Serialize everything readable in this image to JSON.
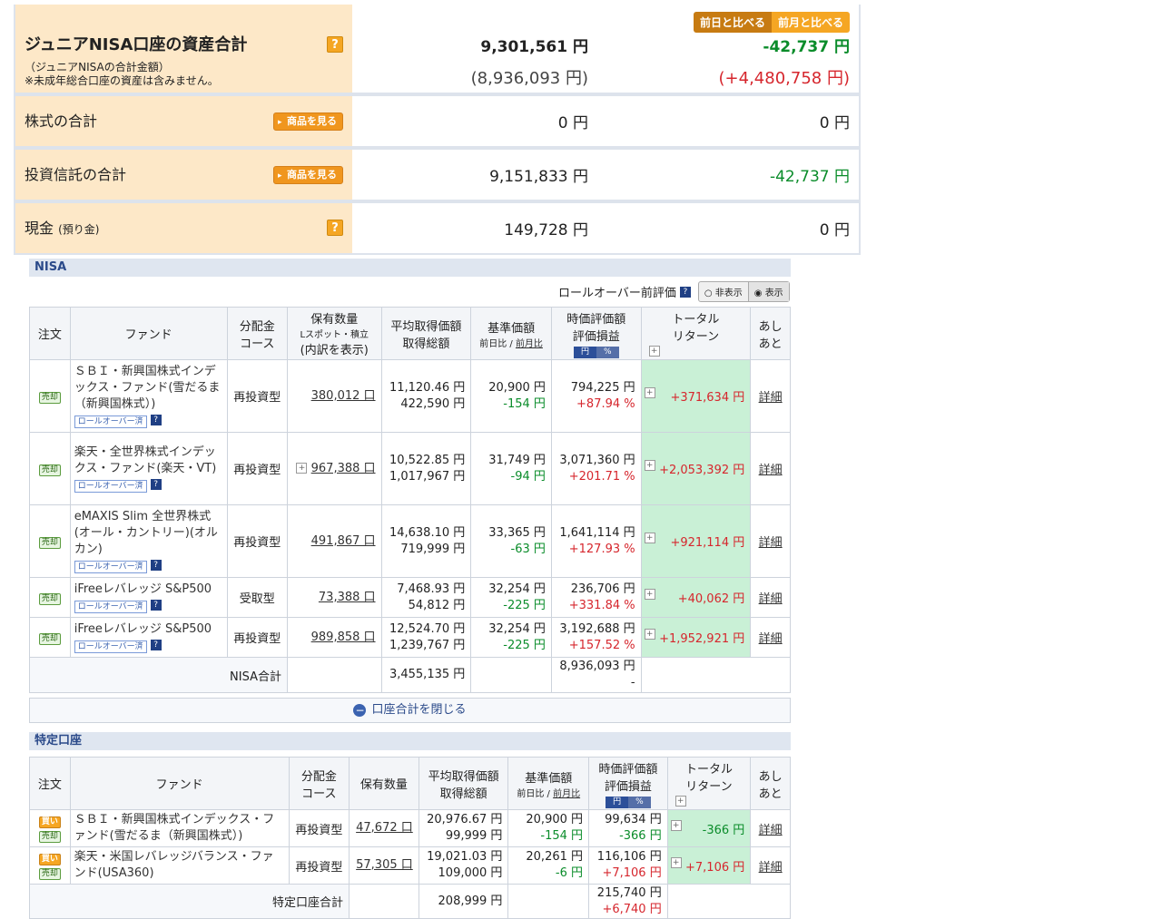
{
  "summary": {
    "total_label": "ジュニアNISA口座の資産合計",
    "total_sub1": "（ジュニアNISAの合計金額）",
    "total_sub2": "※未成年総合口座の資産は含みません。",
    "total_value": "9,301,561 円",
    "total_value_sub": "(8,936,093 円)",
    "total_diff": "-42,737 円",
    "total_diff_sub": "(+4,480,758 円)",
    "cmp_day": "前日と比べる",
    "cmp_month": "前月と比べる",
    "stocks_label": "株式の合計",
    "stocks_value": "0 円",
    "stocks_diff": "0 円",
    "funds_label": "投資信託の合計",
    "funds_value": "9,151,833 円",
    "funds_diff": "-42,737 円",
    "cash_label": "現金",
    "cash_sub": "(預り金)",
    "cash_value": "149,728 円",
    "cash_diff": "0 円",
    "view_products": "商品を見る",
    "q": "?"
  },
  "nisa": {
    "heading": "NISA",
    "rollover_label": "ロールオーバー前評価",
    "toggle_hide": "非表示",
    "toggle_show": "表示",
    "headers": {
      "order": "注文",
      "fund": "ファンド",
      "dist1": "分配金",
      "dist2": "コース",
      "qty": "保有数量",
      "qty_sub": "Lスポット・積立",
      "qty_sub2": "(内訳を表示)",
      "avg1": "平均取得価額",
      "avg2": "取得総額",
      "base1": "基準価額",
      "base2a": "前日比",
      "base2b": "前月比",
      "eval1": "時価評価額",
      "eval2": "評価損益",
      "yen": "円",
      "pct": "%",
      "tr1": "トータル",
      "tr2": "リターン",
      "ashi1": "あし",
      "ashi2": "あと"
    },
    "sell": "売却",
    "rollover_badge": "ロールオーバー済",
    "detail": "詳細",
    "rows": [
      {
        "fund": "ＳＢＩ・新興国株式インデックス・ファンド(雪だるま（新興国株式）)",
        "dist": "再投資型",
        "qty": "380,012 口",
        "avg": "11,120.46 円",
        "cost": "422,590 円",
        "base": "20,900 円",
        "base_diff": "-154 円",
        "eval": "794,225 円",
        "gain_pct": "+87.94 %",
        "total": "+371,634 円"
      },
      {
        "fund": "楽天・全世界株式インデックス・ファンド(楽天・VT)",
        "dist": "再投資型",
        "qty": "967,388 口",
        "avg": "10,522.85 円",
        "cost": "1,017,967 円",
        "base": "31,749 円",
        "base_diff": "-94 円",
        "eval": "3,071,360 円",
        "gain_pct": "+201.71 %",
        "total": "+2,053,392 円"
      },
      {
        "fund": "eMAXIS Slim 全世界株式(オール・カントリー)(オルカン)",
        "dist": "再投資型",
        "qty": "491,867 口",
        "avg": "14,638.10 円",
        "cost": "719,999 円",
        "base": "33,365 円",
        "base_diff": "-63 円",
        "eval": "1,641,114 円",
        "gain_pct": "+127.93 %",
        "total": "+921,114 円"
      },
      {
        "fund": "iFreeレバレッジ S&P500",
        "dist": "受取型",
        "qty": "73,388 口",
        "avg": "7,468.93 円",
        "cost": "54,812 円",
        "base": "32,254 円",
        "base_diff": "-225 円",
        "eval": "236,706 円",
        "gain_pct": "+331.84 %",
        "total": "+40,062 円"
      },
      {
        "fund": "iFreeレバレッジ S&P500",
        "dist": "再投資型",
        "qty": "989,858 口",
        "avg": "12,524.70 円",
        "cost": "1,239,767 円",
        "base": "32,254 円",
        "base_diff": "-225 円",
        "eval": "3,192,688 円",
        "gain_pct": "+157.52 %",
        "total": "+1,952,921 円"
      }
    ],
    "sum_label": "NISA合計",
    "sum_cost": "3,455,135 円",
    "sum_eval": "8,936,093 円",
    "sum_gain": "-",
    "close_label": "口座合計を閉じる"
  },
  "tokutei": {
    "heading": "特定口座",
    "headers": {
      "qty": "保有数量"
    },
    "buy": "買い",
    "sell": "売却",
    "detail": "詳細",
    "rows": [
      {
        "fund": "ＳＢＩ・新興国株式インデックス・ファンド(雪だるま（新興国株式）)",
        "dist": "再投資型",
        "qty": "47,672 口",
        "avg": "20,976.67 円",
        "cost": "99,999 円",
        "base": "20,900 円",
        "base_diff": "-154 円",
        "eval": "99,634 円",
        "gain": "-366 円",
        "total": "-366 円"
      },
      {
        "fund": "楽天・米国レバレッジバランス・ファンド(USA360)",
        "dist": "再投資型",
        "qty": "57,305 口",
        "avg": "19,021.03 円",
        "cost": "109,000 円",
        "base": "20,261 円",
        "base_diff": "-6 円",
        "eval": "116,106 円",
        "gain": "+7,106 円",
        "total": "+7,106 円"
      }
    ],
    "sum_label": "特定口座合計",
    "sum_cost": "208,999 円",
    "sum_eval": "215,740 円",
    "sum_gain": "+6,740 円"
  }
}
